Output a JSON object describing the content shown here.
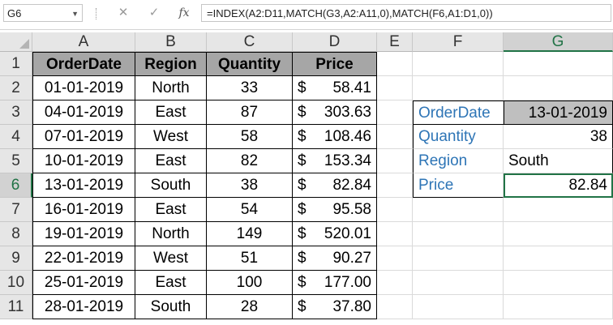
{
  "name_box": "G6",
  "formula": "=INDEX(A2:D11,MATCH(G3,A2:A11,0),MATCH(F6,A1:D1,0))",
  "columns": [
    "A",
    "B",
    "C",
    "D",
    "E",
    "F",
    "G"
  ],
  "rows": [
    "1",
    "2",
    "3",
    "4",
    "5",
    "6",
    "7",
    "8",
    "9",
    "10",
    "11"
  ],
  "table": {
    "headers": [
      "OrderDate",
      "Region",
      "Quantity",
      "Price"
    ],
    "data": [
      {
        "date": "01-01-2019",
        "region": "North",
        "qty": "33",
        "cur": "$",
        "price": "58.41"
      },
      {
        "date": "04-01-2019",
        "region": "East",
        "qty": "87",
        "cur": "$",
        "price": "303.63"
      },
      {
        "date": "07-01-2019",
        "region": "West",
        "qty": "58",
        "cur": "$",
        "price": "108.46"
      },
      {
        "date": "10-01-2019",
        "region": "East",
        "qty": "82",
        "cur": "$",
        "price": "153.34"
      },
      {
        "date": "13-01-2019",
        "region": "South",
        "qty": "38",
        "cur": "$",
        "price": "82.84"
      },
      {
        "date": "16-01-2019",
        "region": "East",
        "qty": "54",
        "cur": "$",
        "price": "95.58"
      },
      {
        "date": "19-01-2019",
        "region": "North",
        "qty": "149",
        "cur": "$",
        "price": "520.01"
      },
      {
        "date": "22-01-2019",
        "region": "West",
        "qty": "51",
        "cur": "$",
        "price": "90.27"
      },
      {
        "date": "25-01-2019",
        "region": "East",
        "qty": "100",
        "cur": "$",
        "price": "177.00"
      },
      {
        "date": "28-01-2019",
        "region": "South",
        "qty": "28",
        "cur": "$",
        "price": "37.80"
      }
    ]
  },
  "lookup": {
    "orderdate_label": "OrderDate",
    "orderdate_value": "13-01-2019",
    "quantity_label": "Quantity",
    "quantity_value": "38",
    "region_label": "Region",
    "region_value": "South",
    "price_label": "Price",
    "price_value": "82.84"
  },
  "colors": {
    "accent": "#217346",
    "label_blue": "#2e75b6",
    "header_fill": "#a6a6a6"
  }
}
